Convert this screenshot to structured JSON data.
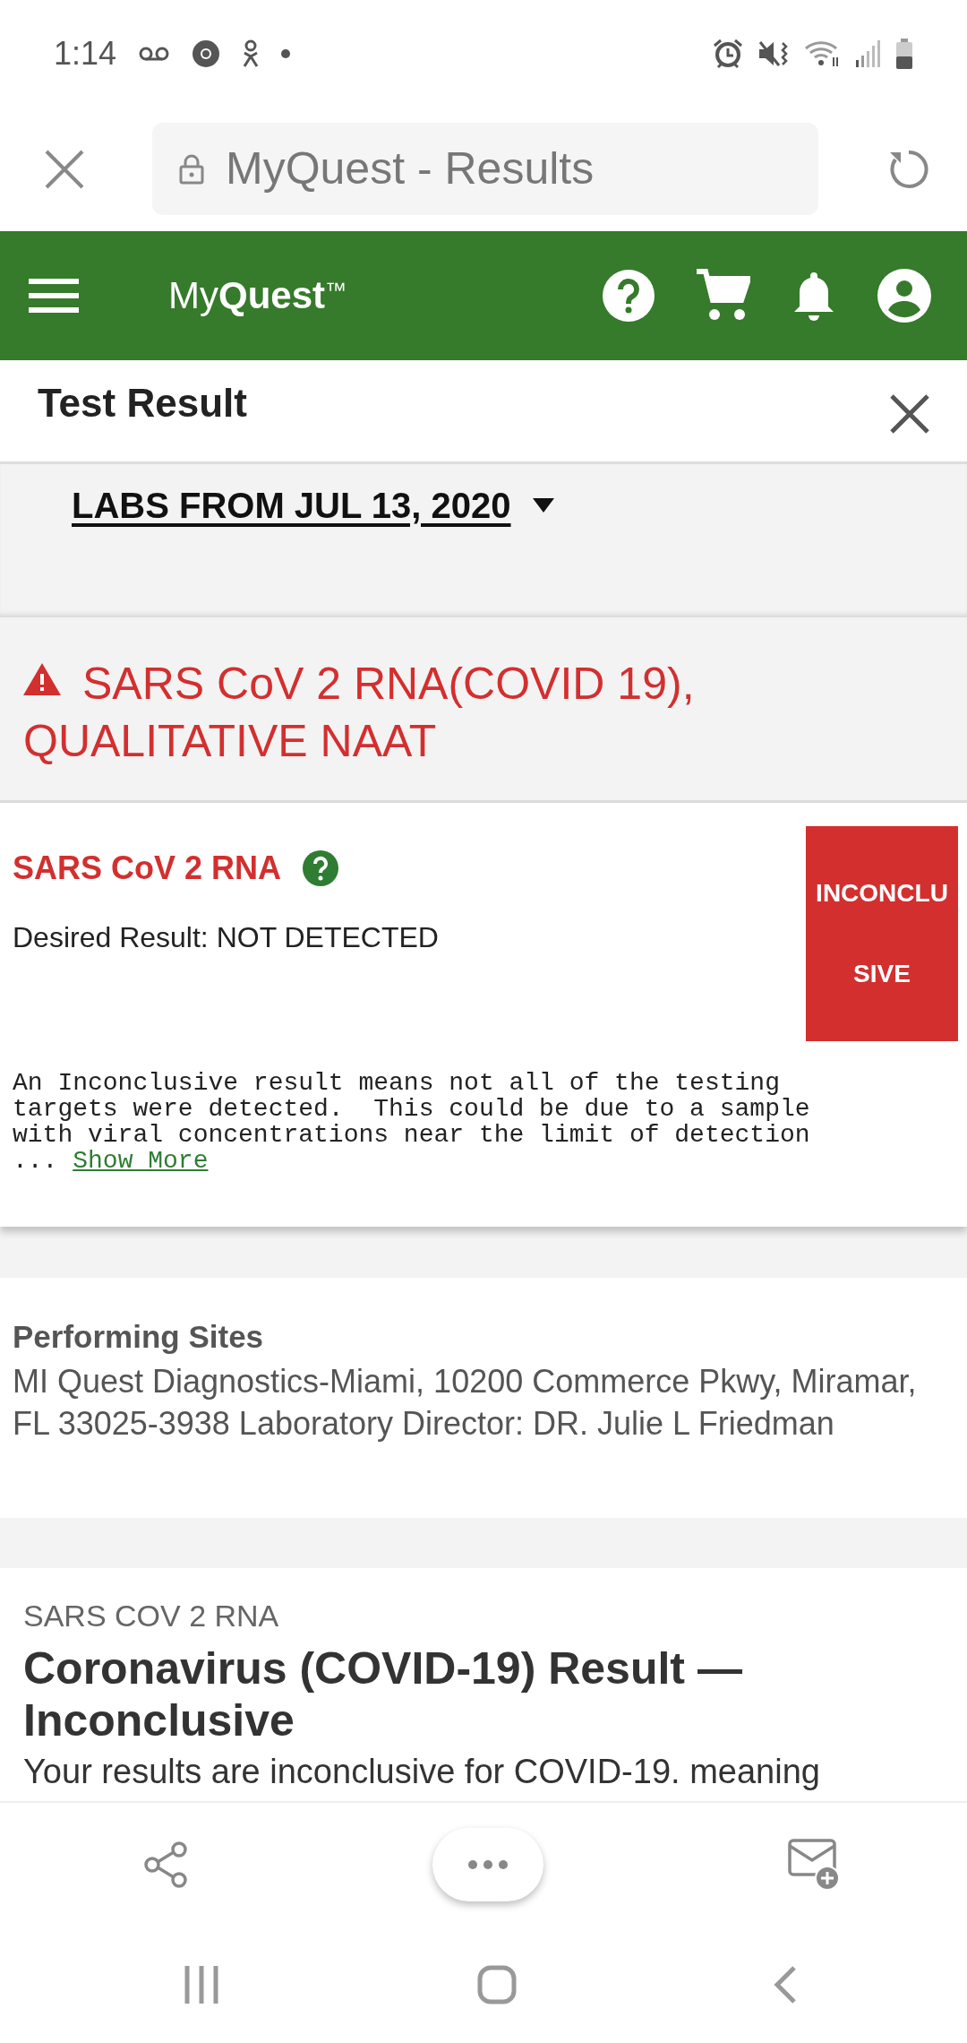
{
  "status_bar": {
    "time": "1:14"
  },
  "browser": {
    "title": "MyQuest - Results",
    "secure": true
  },
  "app_header": {
    "logo": "My**Quest**$^{™}$"
  },
  "page": {
    "title": "Test Result"
  },
  "labs_dropdown": {
    "label": "LABS FROM JUL 13, 2020"
  },
  "test": {
    "title": "SARS CoV 2 RNA(COVID 19), QUALITATIVE NAAT",
    "abnormal": true
  },
  "result": {
    "name": "SARS CoV 2 RNA",
    "desired": "Desired Result: NOT DETECTED",
    "badge_lines": [
      "INCONCLU",
      "SIVE"
    ],
    "note": "An Inconclusive result means not all of the testing\ntargets were detected.  This could be due to a sample\nwith viral concentrations near the limit of detection\n... ",
    "more_link": "Show More"
  },
  "performing_sites": {
    "heading": "Performing Sites",
    "text": "MI Quest Diagnostics-Miami, 10200 Commerce Pkwy, Miramar, FL 33025-3938 Laboratory Director: DR. Julie L Friedman"
  },
  "article": {
    "eyebrow": "SARS COV 2 RNA",
    "heading": "Coronavirus (COVID-19) Result — Inconclusive",
    "body": "Your results are inconclusive for COVID-19. meaning"
  }
}
